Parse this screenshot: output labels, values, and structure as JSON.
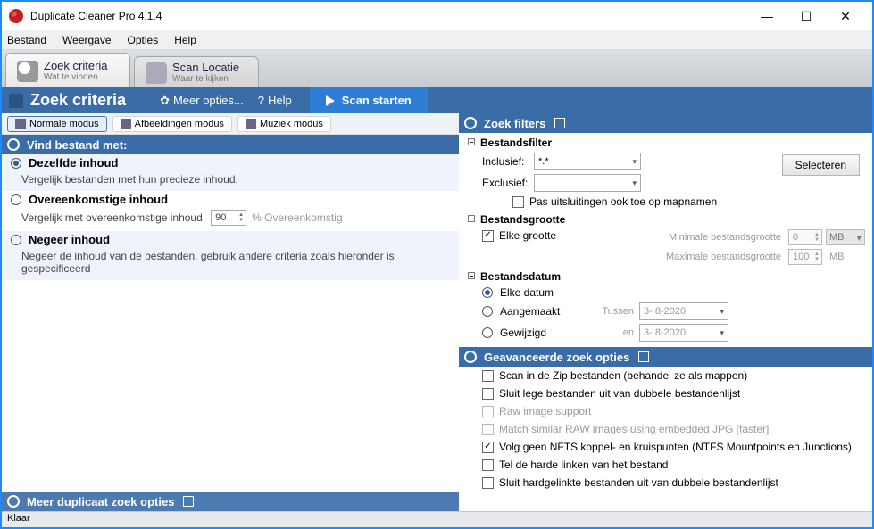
{
  "window": {
    "title": "Duplicate Cleaner Pro 4.1.4"
  },
  "menu": {
    "bestand": "Bestand",
    "weergave": "Weergave",
    "opties": "Opties",
    "help": "Help"
  },
  "tabs": {
    "search": {
      "label": "Zoek criteria",
      "sub": "Wat te vinden"
    },
    "loc": {
      "label": "Scan Locatie",
      "sub": "Waar te kijken"
    }
  },
  "bluebar": {
    "title": "Zoek criteria",
    "more": "Meer opties...",
    "help": "Help",
    "scan": "Scan starten"
  },
  "modes": {
    "normal": "Normale modus",
    "images": "Afbeeldingen modus",
    "music": "Muziek modus"
  },
  "find": {
    "head": "Vind bestand met:",
    "same": {
      "label": "Dezelfde inhoud",
      "desc": "Vergelijk bestanden met hun precieze inhoud."
    },
    "similar": {
      "label": "Overeenkomstige inhoud",
      "desc": "Vergelijk met overeenkomstige inhoud.",
      "pct": "90",
      "pctlabel": "% Overeenkomstig"
    },
    "ignore": {
      "label": "Negeer inhoud",
      "desc": "Negeer de inhoud van de bestanden, gebruik andere criteria zoals hieronder is gespecificeerd"
    }
  },
  "filters": {
    "head": "Zoek filters",
    "file": {
      "head": "Bestandsfilter",
      "incl": "Inclusief:",
      "incl_val": "*.*",
      "excl": "Exclusief:",
      "select": "Selecteren",
      "dirs": "Pas uitsluitingen ook toe op mapnamen"
    },
    "size": {
      "head": "Bestandsgrootte",
      "any": "Elke grootte",
      "min": "Minimale bestandsgrootte",
      "minv": "0",
      "max": "Maximale bestandsgrootte",
      "maxv": "100",
      "unit": "MB"
    },
    "date": {
      "head": "Bestandsdatum",
      "any": "Elke datum",
      "created": "Aangemaakt",
      "between": "Tussen",
      "d1": "3- 8-2020",
      "modified": "Gewijzigd",
      "en": "en",
      "d2": "3- 8-2020"
    }
  },
  "adv": {
    "head": "Geavanceerde zoek opties",
    "zip": "Scan in de Zip bestanden (behandel ze als mappen)",
    "empty": "Sluit lege bestanden uit van dubbele bestandenlijst",
    "raw": "Raw image support",
    "rawjpg": "Match similar RAW images using embedded JPG [faster]",
    "ntfs": "Volg geen NFTS koppel- en kruispunten (NTFS Mountpoints en Junctions)",
    "hard": "Tel de harde linken van het bestand",
    "hardex": "Sluit hardgelinkte bestanden uit van dubbele bestandenlijst"
  },
  "moreopts": "Meer duplicaat zoek opties",
  "status": "Klaar"
}
